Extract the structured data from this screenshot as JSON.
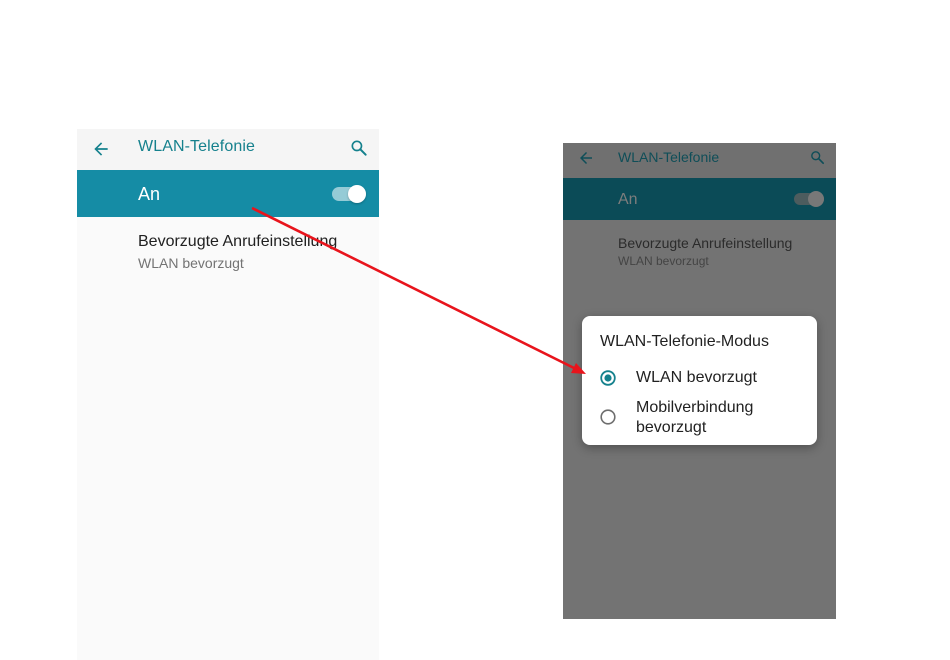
{
  "left_screen": {
    "appbar": {
      "title": "WLAN-Telefonie",
      "back_icon": "arrow-back-icon",
      "search_icon": "search-icon"
    },
    "master_switch": {
      "label": "An",
      "state": "on"
    },
    "preference": {
      "title": "Bevorzugte Anrufeinstellung",
      "summary": "WLAN bevorzugt"
    }
  },
  "right_screen": {
    "appbar": {
      "title": "WLAN-Telefonie",
      "back_icon": "arrow-back-icon",
      "search_icon": "search-icon"
    },
    "master_switch": {
      "label": "An",
      "state": "on"
    },
    "preference": {
      "title": "Bevorzugte Anrufeinstellung",
      "summary": "WLAN bevorzugt"
    },
    "dialog": {
      "title": "WLAN-Telefonie-Modus",
      "options": [
        {
          "label": "WLAN bevorzugt",
          "selected": true
        },
        {
          "label": "Mobilverbindung bevorzugt",
          "selected": false
        }
      ]
    }
  },
  "colors": {
    "accent": "#15818d",
    "switchbar": "#158ca5",
    "scrim": "#737373",
    "annotation_arrow": "#e8141c"
  }
}
